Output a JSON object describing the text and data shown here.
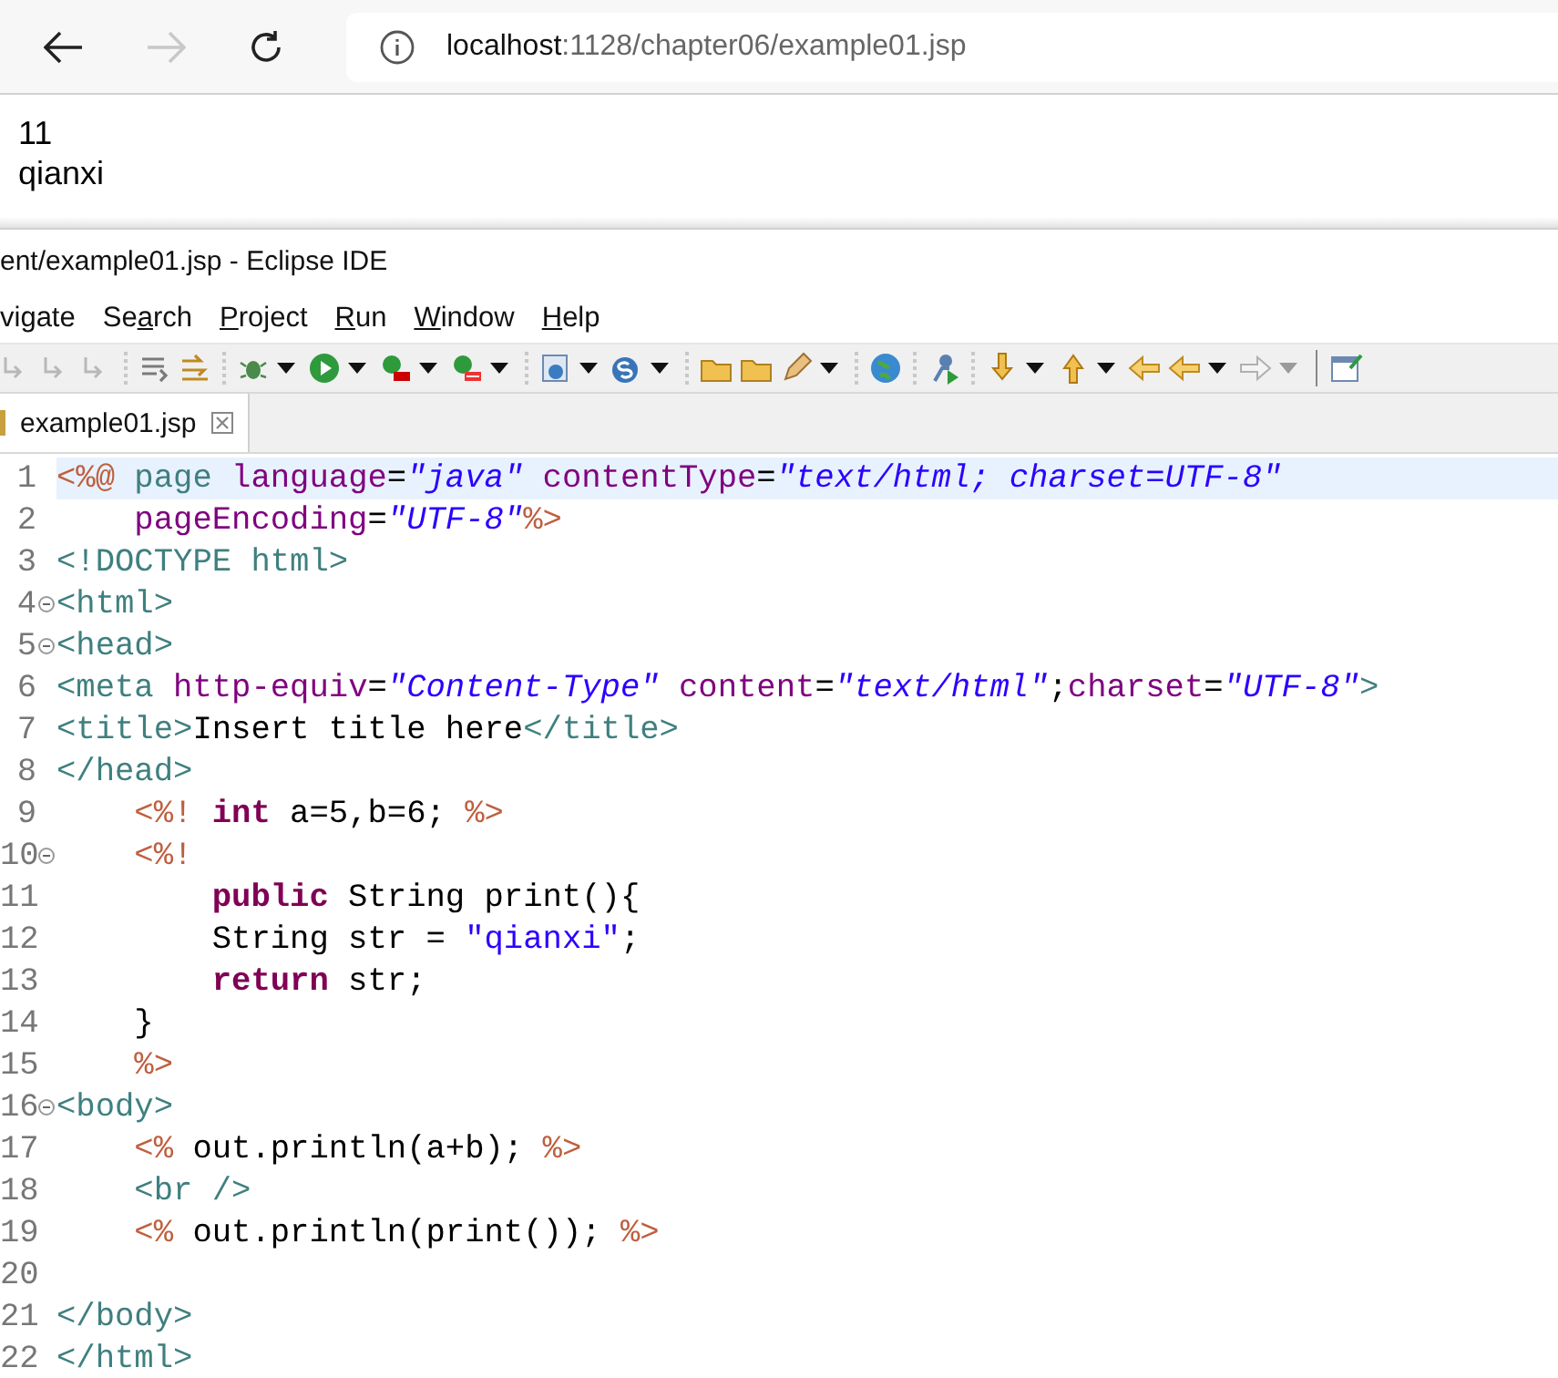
{
  "browser": {
    "nav_buttons": [
      {
        "kind": "back",
        "disabled": false
      },
      {
        "kind": "forward",
        "disabled": true
      },
      {
        "kind": "reload",
        "disabled": false
      }
    ],
    "address": {
      "host": "localhost",
      "path": ":1128/chapter06/example01.jsp"
    }
  },
  "page_output": [
    "11",
    "qianxi"
  ],
  "eclipse": {
    "window": {
      "title": "ent/example01.jsp - Eclipse IDE"
    },
    "menu": [
      {
        "before": "vigate"
      },
      {
        "before": "Se",
        "key": "a",
        "after": "rch"
      },
      {
        "key": "P",
        "after": "roject"
      },
      {
        "key": "R",
        "after": "un"
      },
      {
        "key": "W",
        "after": "indow"
      },
      {
        "key": "H",
        "after": "elp"
      }
    ],
    "tabs": [
      {
        "label": "example01.jsp",
        "selected": true
      }
    ],
    "editor": {
      "lines": [
        {
          "number": "1",
          "fold": false,
          "current": true,
          "tokens": [
            {
              "kind": "jsp",
              "text": "<%@"
            },
            {
              "kind": "directive",
              "text": " page"
            },
            {
              "kind": "attr",
              "text": " language"
            },
            {
              "kind": "plain",
              "text": "="
            },
            {
              "kind": "string",
              "text": "\"java\""
            },
            {
              "kind": "attr",
              "text": " contentType"
            },
            {
              "kind": "plain",
              "text": "="
            },
            {
              "kind": "string",
              "text": "\"text/html; charset=UTF-8\""
            }
          ]
        },
        {
          "number": "2",
          "fold": false,
          "current": false,
          "tokens": [
            {
              "kind": "attr",
              "text": "    pageEncoding"
            },
            {
              "kind": "plain",
              "text": "="
            },
            {
              "kind": "string",
              "text": "\"UTF-8\""
            },
            {
              "kind": "jsp",
              "text": "%>"
            }
          ]
        },
        {
          "number": "3",
          "fold": false,
          "current": false,
          "tokens": [
            {
              "kind": "tag",
              "text": "<!DOCTYPE html>"
            }
          ]
        },
        {
          "number": "4",
          "fold": true,
          "current": false,
          "tokens": [
            {
              "kind": "tag",
              "text": "<html>"
            }
          ]
        },
        {
          "number": "5",
          "fold": true,
          "current": false,
          "tokens": [
            {
              "kind": "tag",
              "text": "<head>"
            }
          ]
        },
        {
          "number": "6",
          "fold": false,
          "current": false,
          "tokens": [
            {
              "kind": "tag",
              "text": "<meta"
            },
            {
              "kind": "attr",
              "text": " http-equiv"
            },
            {
              "kind": "plain",
              "text": "="
            },
            {
              "kind": "string",
              "text": "\"Content-Type\""
            },
            {
              "kind": "attr",
              "text": " content"
            },
            {
              "kind": "plain",
              "text": "="
            },
            {
              "kind": "string",
              "text": "\"text/html\""
            },
            {
              "kind": "plain",
              "text": ";"
            },
            {
              "kind": "attr",
              "text": "charset"
            },
            {
              "kind": "plain",
              "text": "="
            },
            {
              "kind": "string",
              "text": "\"UTF-8\""
            },
            {
              "kind": "tag",
              "text": ">"
            }
          ]
        },
        {
          "number": "7",
          "fold": false,
          "current": false,
          "tokens": [
            {
              "kind": "tag",
              "text": "<title>"
            },
            {
              "kind": "plain",
              "text": "Insert title here"
            },
            {
              "kind": "tag",
              "text": "</title>"
            }
          ]
        },
        {
          "number": "8",
          "fold": false,
          "current": false,
          "tokens": [
            {
              "kind": "tag",
              "text": "</head>"
            }
          ]
        },
        {
          "number": "9",
          "fold": false,
          "current": false,
          "tokens": [
            {
              "kind": "jsp",
              "text": "    <%!"
            },
            {
              "kind": "keyword",
              "text": " int"
            },
            {
              "kind": "plain",
              "text": " a=5,b=6; "
            },
            {
              "kind": "jsp",
              "text": "%>"
            }
          ]
        },
        {
          "number": "10",
          "fold": true,
          "current": false,
          "tokens": [
            {
              "kind": "jsp",
              "text": "    <%!"
            }
          ]
        },
        {
          "number": "11",
          "fold": false,
          "current": false,
          "tokens": [
            {
              "kind": "keyword",
              "text": "        public"
            },
            {
              "kind": "plain",
              "text": " String print(){"
            }
          ]
        },
        {
          "number": "12",
          "fold": false,
          "current": false,
          "tokens": [
            {
              "kind": "plain",
              "text": "        String str = "
            },
            {
              "kind": "javastring",
              "text": "\"qianxi\""
            },
            {
              "kind": "plain",
              "text": ";"
            }
          ]
        },
        {
          "number": "13",
          "fold": false,
          "current": false,
          "tokens": [
            {
              "kind": "keyword",
              "text": "        return"
            },
            {
              "kind": "plain",
              "text": " str;"
            }
          ]
        },
        {
          "number": "14",
          "fold": false,
          "current": false,
          "tokens": [
            {
              "kind": "plain",
              "text": "    }"
            }
          ]
        },
        {
          "number": "15",
          "fold": false,
          "current": false,
          "tokens": [
            {
              "kind": "jsp",
              "text": "    %>"
            }
          ]
        },
        {
          "number": "16",
          "fold": true,
          "current": false,
          "tokens": [
            {
              "kind": "tag",
              "text": "<body>"
            }
          ]
        },
        {
          "number": "17",
          "fold": false,
          "current": false,
          "tokens": [
            {
              "kind": "jsp",
              "text": "    <%"
            },
            {
              "kind": "plain",
              "text": " out.println(a+b); "
            },
            {
              "kind": "jsp",
              "text": "%>"
            }
          ]
        },
        {
          "number": "18",
          "fold": false,
          "current": false,
          "tokens": [
            {
              "kind": "tag",
              "text": "    <br />"
            }
          ]
        },
        {
          "number": "19",
          "fold": false,
          "current": false,
          "tokens": [
            {
              "kind": "jsp",
              "text": "    <%"
            },
            {
              "kind": "plain",
              "text": " out.println(print()); "
            },
            {
              "kind": "jsp",
              "text": "%>"
            }
          ]
        },
        {
          "number": "20",
          "fold": false,
          "current": false
        },
        {
          "number": "21",
          "fold": false,
          "current": false,
          "tokens": [
            {
              "kind": "tag",
              "text": "</body>"
            }
          ]
        },
        {
          "number": "22",
          "fold": false,
          "current": false,
          "tokens": [
            {
              "kind": "tag",
              "text": "</html>"
            }
          ]
        }
      ]
    }
  }
}
